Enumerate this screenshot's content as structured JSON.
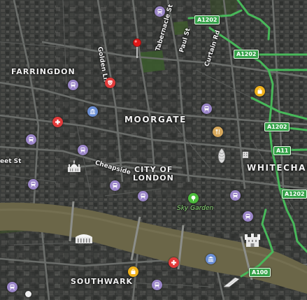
{
  "map": {
    "style": "satellite-hybrid",
    "colors": {
      "river": "#6f6a4f",
      "green_road": "#48b85a",
      "transit_poi": "#9b86c9",
      "hospital_poi": "#e33b3b",
      "museum_poi": "#6b8fd6",
      "restaurant_poi": "#d7a85b",
      "shopping_poi": "#f0b21c",
      "park_poi": "#4bbb3b",
      "pin": "#e01818"
    }
  },
  "labels": {
    "districts": {
      "farringdon": "FARRINGDON",
      "moorgate": "MOORGATE",
      "city_of_london_1": "CITY OF",
      "city_of_london_2": "LONDON",
      "whitechapel": "WHITECHAPE",
      "southwark": "SOUTHWARK"
    },
    "streets": {
      "golden_ln": "Golden Ln",
      "tabernacle_st": "Tabernacle St",
      "paul_st": "Paul St",
      "curtain_rd": "Curtain Rd",
      "cheapside": "Cheapside",
      "fleet_st": "eet St"
    },
    "road_shields": {
      "a1202_top": "A1202",
      "a1202_mid": "A1202",
      "a1202_right": "A1202",
      "a1202_low": "A1202",
      "a11": "A11",
      "a100": "A100"
    },
    "pois": {
      "sky_garden": "Sky Garden"
    }
  },
  "icons": {
    "transit": "tube-icon",
    "hospital": "hospital-cross-icon",
    "museum": "museum-icon",
    "restaurant": "fork-knife-icon",
    "shopping": "shopping-bag-icon",
    "park": "tree-icon",
    "theatre": "theatre-mask-icon",
    "pin": "location-pin-icon",
    "cathedral": "cathedral-landmark-icon",
    "tower": "tower-of-london-icon",
    "gherkin": "gherkin-landmark-icon"
  }
}
